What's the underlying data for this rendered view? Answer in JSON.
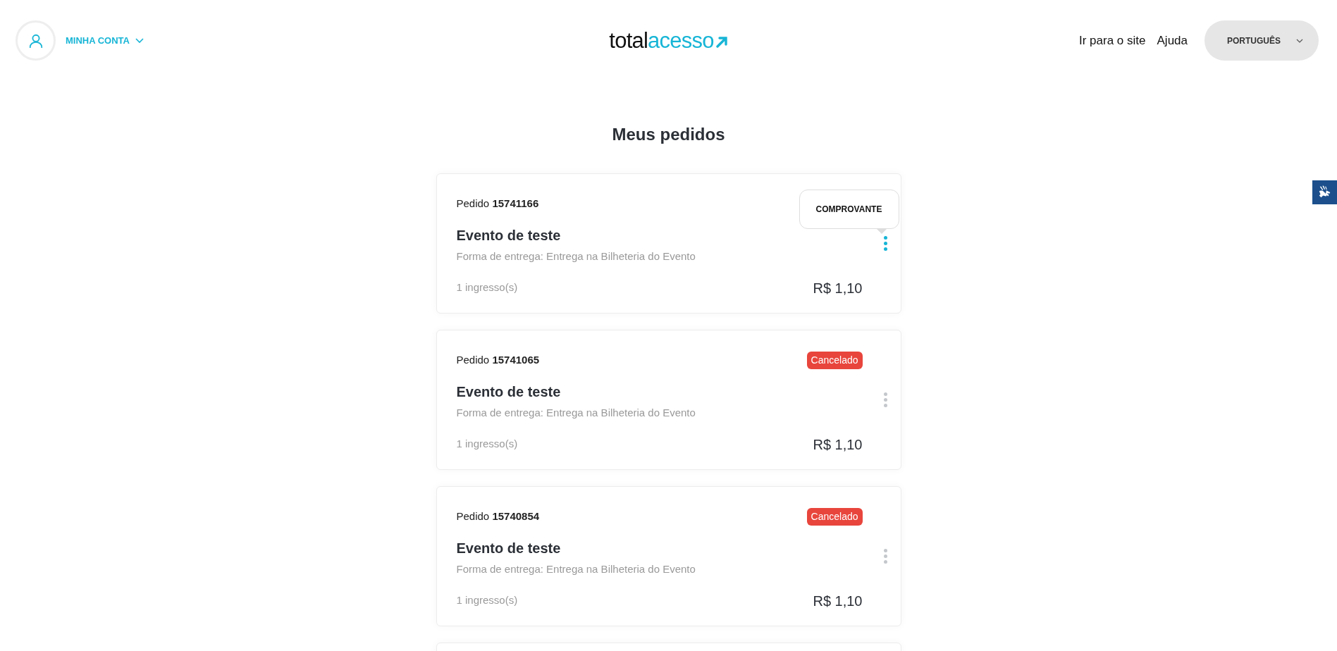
{
  "header": {
    "account": {
      "label": "MINHA CONTA"
    },
    "logo": {
      "part_1": "total",
      "part_2": "acesso"
    },
    "links": [
      "Ir para o site",
      "Ajuda"
    ],
    "language": {
      "label": "PORTUGUÊS"
    }
  },
  "title": "Meus pedidos",
  "orders": [
    {
      "prefix": "Pedido",
      "number": "15741166",
      "event": "Evento de teste",
      "delivery": "Forma de entrega: Entrega na Bilheteria do Evento",
      "tickets": "1 ingresso(s)",
      "price": "R$ 1,10",
      "menu_open": true,
      "menu_items": [
        "COMPROVANTE"
      ]
    },
    {
      "prefix": "Pedido",
      "number": "15741065",
      "status": "Cancelado",
      "color": "#e8453c",
      "event": "Evento de teste",
      "delivery": "Forma de entrega: Entrega na Bilheteria do Evento",
      "tickets": "1 ingresso(s)",
      "price": "R$ 1,10",
      "menu_open": false
    },
    {
      "prefix": "Pedido",
      "number": "15740854",
      "status": "Cancelado",
      "color": "#e8453c",
      "event": "Evento de teste",
      "delivery": "Forma de entrega: Entrega na Bilheteria do Evento",
      "tickets": "1 ingresso(s)",
      "price": "R$ 1,10",
      "menu_open": false
    }
  ]
}
